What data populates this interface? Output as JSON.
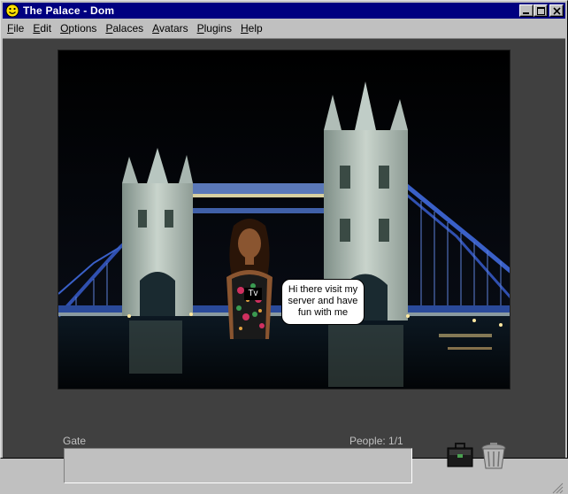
{
  "window": {
    "title": "The Palace - Dom"
  },
  "menu": [
    {
      "accel": "F",
      "rest": "ile"
    },
    {
      "accel": "E",
      "rest": "dit"
    },
    {
      "accel": "O",
      "rest": "ptions"
    },
    {
      "accel": "P",
      "rest": "alaces"
    },
    {
      "accel": "A",
      "rest": "vatars"
    },
    {
      "accel": "P",
      "rest": "lugins"
    },
    {
      "accel": "H",
      "rest": "elp"
    }
  ],
  "scene": {
    "avatar_name": "Tv",
    "chat_bubble": "Hi there visit my server and have fun with me"
  },
  "status": {
    "room_name": "Gate",
    "people": "People: 1/1"
  },
  "chat": {
    "value": ""
  },
  "colors": {
    "titlebar": "#000080",
    "chrome": "#c0c0c0",
    "client_bg": "#404040"
  },
  "icons": [
    "smiley-app-icon",
    "minimize-icon",
    "maximize-icon",
    "close-icon",
    "briefcase-icon",
    "trash-can-icon",
    "resize-grip-icon"
  ]
}
